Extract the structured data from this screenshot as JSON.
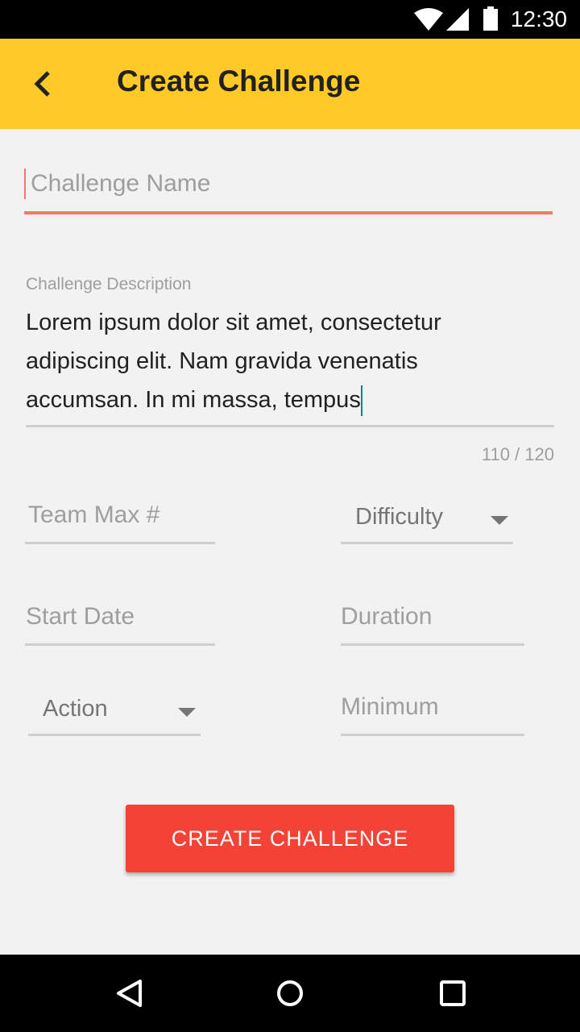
{
  "status_bar": {
    "time": "12:30",
    "icons": [
      "wifi-icon",
      "signal-icon",
      "battery-icon"
    ]
  },
  "app_bar": {
    "title": "Create Challenge",
    "back_icon": "chevron-left-icon",
    "color": "#ffca28"
  },
  "form": {
    "name": {
      "placeholder": "Challenge Name",
      "value": "",
      "accent": "#f47b67"
    },
    "description": {
      "label": "Challenge Description",
      "value": "Lorem ipsum dolor sit amet, consectetur adipiscing elit. Nam gravida venenatis accumsan. In mi massa, tempus",
      "counter": "110 / 120"
    },
    "team_max": {
      "placeholder": "Team Max #"
    },
    "difficulty": {
      "selected": "Difficulty"
    },
    "start_date": {
      "placeholder": "Start Date"
    },
    "duration": {
      "placeholder": "Duration"
    },
    "action": {
      "selected": "Action"
    },
    "minimum": {
      "placeholder": "Minimum"
    },
    "submit_label": "CREATE CHALLENGE",
    "submit_color": "#f44336"
  },
  "nav_bar": {
    "icons": [
      "back-triangle-icon",
      "home-circle-icon",
      "recents-square-icon"
    ]
  }
}
